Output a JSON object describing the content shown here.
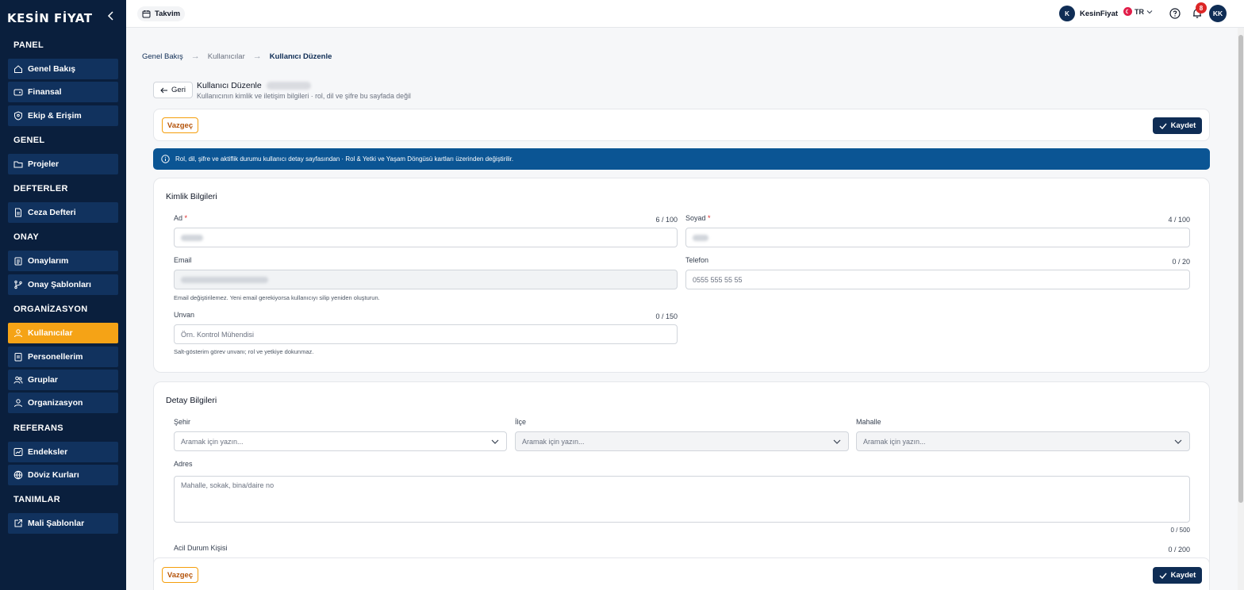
{
  "app": {
    "logo": "KESİN FİYAT"
  },
  "sidebar": {
    "sections": [
      {
        "title": "PANEL",
        "items": [
          {
            "label": "Genel Bakış",
            "icon": "home-icon"
          },
          {
            "label": "Finansal",
            "icon": "wallet-icon"
          },
          {
            "label": "Ekip & Erişim",
            "icon": "shield-user-icon"
          }
        ]
      },
      {
        "title": "GENEL",
        "items": [
          {
            "label": "Projeler",
            "icon": "folder-icon"
          }
        ]
      },
      {
        "title": "DEFTERLER",
        "items": [
          {
            "label": "Ceza Defteri",
            "icon": "document-icon"
          }
        ]
      },
      {
        "title": "ONAY",
        "items": [
          {
            "label": "Onaylarım",
            "icon": "clipboard-icon"
          },
          {
            "label": "Onay Şablonları",
            "icon": "git-branch-icon"
          }
        ]
      },
      {
        "title": "ORGANİZASYON",
        "items": [
          {
            "label": "Kullanıcılar",
            "icon": "user-icon",
            "active": true
          },
          {
            "label": "Personellerim",
            "icon": "id-card-icon"
          },
          {
            "label": "Gruplar",
            "icon": "users-icon"
          },
          {
            "label": "Organizasyon",
            "icon": "org-user-icon"
          }
        ]
      },
      {
        "title": "REFERANS",
        "items": [
          {
            "label": "Endeksler",
            "icon": "chart-icon"
          },
          {
            "label": "Döviz Kurları",
            "icon": "globe-icon"
          }
        ]
      },
      {
        "title": "TANIMLAR",
        "items": [
          {
            "label": "Mali Şablonlar",
            "icon": "external-doc-icon"
          }
        ]
      }
    ]
  },
  "topbar": {
    "calendar_label": "Takvim",
    "org_initial": "K",
    "org_name": "KesinFiyat",
    "lang": "TR",
    "notifications": "8",
    "user_initials": "KK"
  },
  "breadcrumb": {
    "home": "Genel Bakış",
    "parent": "Kullanıcılar",
    "current": "Kullanıcı Düzenle"
  },
  "header": {
    "back_label": "Geri",
    "title": "Kullanıcı Düzenle",
    "subtitle": "Kullanıcının kimlik ve iletişim bilgileri · rol, dil ve şifre bu sayfada değil"
  },
  "actions": {
    "cancel": "Vazgeç",
    "save": "Kaydet"
  },
  "info_banner": "Rol, dil, şifre ve aktiflik durumu kullanıcı detay sayfasından · Rol & Yetki ve Yaşam Döngüsü kartları üzerinden değiştirilir.",
  "identity": {
    "title": "Kimlik Bilgileri",
    "ad": {
      "label": "Ad",
      "required": "*",
      "count": "6 / 100"
    },
    "soyad": {
      "label": "Soyad",
      "required": "*",
      "count": "4 / 100"
    },
    "email": {
      "label": "Email",
      "hint": "Email değiştirilemez. Yeni email gerekiyorsa kullanıcıyı silip yeniden oluşturun."
    },
    "telefon": {
      "label": "Telefon",
      "count": "0 / 20",
      "placeholder": "0555 555 55 55"
    },
    "unvan": {
      "label": "Unvan",
      "count": "0 / 150",
      "placeholder": "Örn. Kontrol Mühendisi",
      "hint": "Salt-gösterim görev unvanı; rol ve yetkiye dokunmaz."
    }
  },
  "details": {
    "title": "Detay Bilgileri",
    "sehir": {
      "label": "Şehir",
      "placeholder": "Aramak için yazın..."
    },
    "ilce": {
      "label": "İlçe",
      "placeholder": "Aramak için yazın..."
    },
    "mahalle": {
      "label": "Mahalle",
      "placeholder": "Aramak için yazın..."
    },
    "adres": {
      "label": "Adres",
      "placeholder": "Mahalle, sokak, bina/daire no",
      "count": "0 / 500"
    },
    "acil": {
      "label": "Acil Durum Kişisi",
      "count": "0 / 200"
    }
  }
}
